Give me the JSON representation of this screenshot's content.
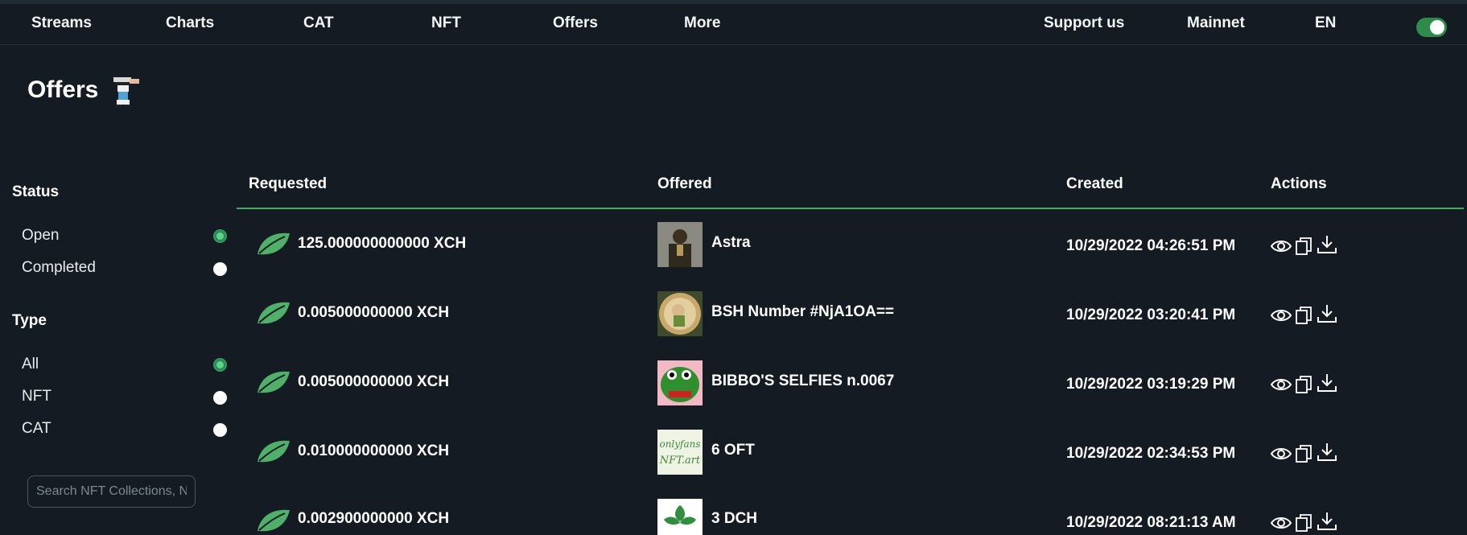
{
  "nav": {
    "items": [
      "Streams",
      "Charts",
      "CAT",
      "NFT",
      "Offers",
      "More"
    ],
    "support": "Support us",
    "network": "Mainnet",
    "language": "EN",
    "theme_toggle_on": true
  },
  "page": {
    "title": "Offers"
  },
  "filters": {
    "status": {
      "heading": "Status",
      "options": [
        "Open",
        "Completed"
      ],
      "selected": "Open"
    },
    "type": {
      "heading": "Type",
      "options": [
        "All",
        "NFT",
        "CAT"
      ],
      "selected": "All"
    },
    "search_placeholder": "Search NFT Collections, NFTs and CATs"
  },
  "table": {
    "headers": [
      "Requested",
      "Offered",
      "Created",
      "Actions"
    ],
    "rows": [
      {
        "requested": "125.000000000000 XCH",
        "offered": "Astra",
        "created": "10/29/2022 04:26:51 PM"
      },
      {
        "requested": "0.005000000000 XCH",
        "offered": "BSH Number #NjA1OA==",
        "created": "10/29/2022 03:20:41 PM"
      },
      {
        "requested": "0.005000000000 XCH",
        "offered": "BIBBO'S SELFIES n.0067",
        "created": "10/29/2022 03:19:29 PM"
      },
      {
        "requested": "0.010000000000 XCH",
        "offered": "6 OFT",
        "created": "10/29/2022 02:34:53 PM"
      },
      {
        "requested": "0.002900000000 XCH",
        "offered": "3 DCH",
        "created": "10/29/2022 08:21:13 AM"
      }
    ],
    "thumb_texts": {
      "row4_line1": "onlyfans",
      "row4_line2": "NFT.art"
    }
  },
  "colors": {
    "background": "#141b22",
    "accent_green": "#3fae5a",
    "leaf_green": "#4fb06a"
  },
  "icons": [
    "leaf-icon",
    "eye-icon",
    "copy-icon",
    "download-icon"
  ]
}
